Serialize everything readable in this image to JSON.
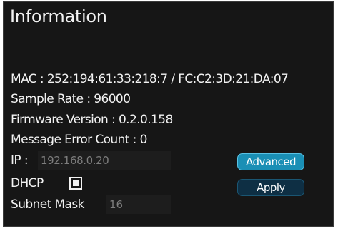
{
  "panel": {
    "title": "Information"
  },
  "info": {
    "mac_label": "MAC : ",
    "mac_value": "252:194:61:33:218:7 / FC:C2:3D:21:DA:07",
    "sample_rate_label": "Sample Rate : ",
    "sample_rate_value": "96000",
    "firmware_label": "Firmware Version : ",
    "firmware_value": "0.2.0.158",
    "error_count_label": "Message Error Count : ",
    "error_count_value": "0"
  },
  "network": {
    "ip_label": "IP :",
    "ip_value": "192.168.0.20",
    "dhcp_label": "DHCP",
    "dhcp_checked": true,
    "subnet_label": "Subnet Mask",
    "subnet_value": "16"
  },
  "buttons": {
    "advanced_label": "Advanced",
    "apply_label": "Apply"
  },
  "colors": {
    "panel_background": "#161616",
    "text": "#f2f2f2",
    "field_text": "#7d7d7d",
    "advanced_button": "#1a8fb5",
    "apply_button": "#0e2f44"
  }
}
